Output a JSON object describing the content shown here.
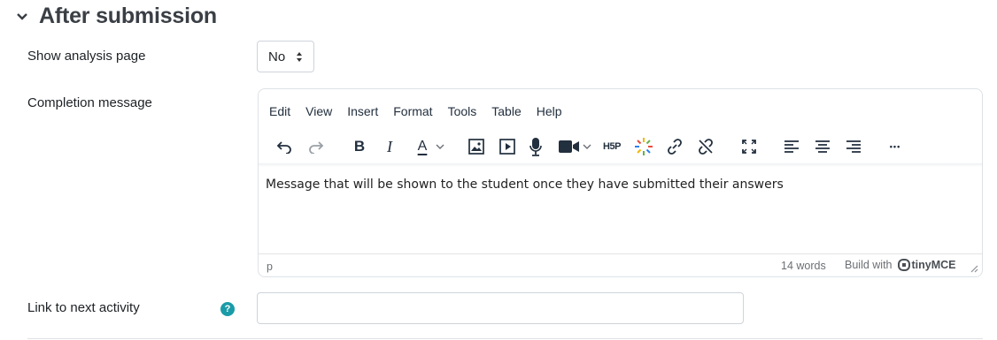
{
  "section": {
    "title": "After submission"
  },
  "fields": {
    "show_analysis": {
      "label": "Show analysis page",
      "value": "No"
    },
    "completion": {
      "label": "Completion message"
    },
    "next_activity": {
      "label": "Link to next activity",
      "help": "?",
      "value": ""
    }
  },
  "editor": {
    "menu": [
      "Edit",
      "View",
      "Insert",
      "Format",
      "Tools",
      "Table",
      "Help"
    ],
    "toolbar_icons": [
      "undo-icon",
      "redo-icon",
      "bold-icon",
      "italic-icon",
      "text-color-icon",
      "image-icon",
      "media-icon",
      "microphone-icon",
      "video-camera-icon",
      "h5p-icon",
      "sparkle-icon",
      "link-icon",
      "unlink-icon",
      "fullscreen-icon",
      "align-left-icon",
      "align-center-icon",
      "align-right-icon",
      "more-icon"
    ],
    "bold_glyph": "B",
    "italic_glyph": "I",
    "textcolor_glyph": "A",
    "h5p_label": "H5P",
    "more_glyph": "•••",
    "content": "Message that will be shown to the student once they have submitted their answers",
    "status": {
      "path": "p",
      "words": "14 words",
      "build": "Build with",
      "brand": "tinyMCE"
    }
  },
  "colors": {
    "help_badge": "#1a9ca8",
    "sparkle": [
      "#f2b707",
      "#6ab04c",
      "#e84d3d",
      "#2f80ed"
    ]
  }
}
